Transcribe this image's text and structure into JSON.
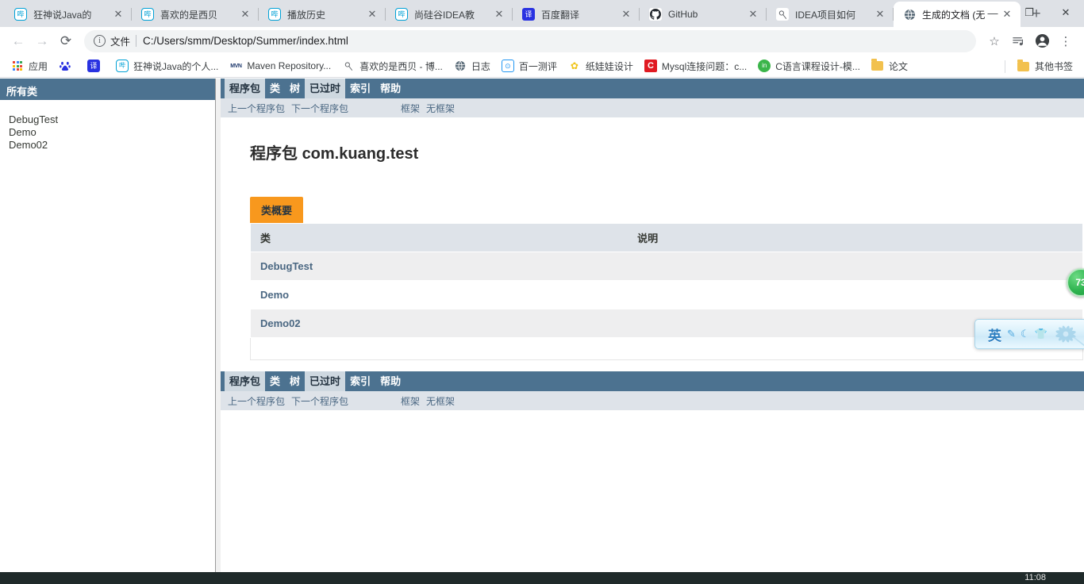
{
  "browser": {
    "tabs": [
      {
        "title": "狂神说Java的",
        "favicon": "bilibili-icon",
        "favicon_glyph": "哔",
        "active": false,
        "closable": true
      },
      {
        "title": "喜欢的是西贝",
        "favicon": "bilibili-icon",
        "favicon_glyph": "哔",
        "active": false,
        "closable": true
      },
      {
        "title": "播放历史",
        "favicon": "bilibili-icon",
        "favicon_glyph": "哔",
        "active": false,
        "closable": true
      },
      {
        "title": "尚硅谷IDEA教",
        "favicon": "bilibili-icon",
        "favicon_glyph": "哔",
        "active": false,
        "closable": true
      },
      {
        "title": "百度翻译",
        "favicon": "translate-icon",
        "favicon_glyph": "译",
        "active": false,
        "closable": true
      },
      {
        "title": "GitHub",
        "favicon": "github-icon",
        "favicon_glyph": "◉",
        "active": false,
        "closable": true
      },
      {
        "title": "IDEA项目如何",
        "favicon": "idea-icon",
        "favicon_glyph": "⌖",
        "active": false,
        "closable": true
      },
      {
        "title": "生成的文档 (无",
        "favicon": "globe-icon",
        "favicon_glyph": "🌐",
        "active": true,
        "closable": true
      }
    ],
    "new_tab_label": "+",
    "close_glyph": "✕",
    "window_controls": {
      "minimize": "—",
      "maximize": "❐",
      "close": "✕"
    },
    "toolbar": {
      "back_glyph": "←",
      "forward_glyph": "→",
      "reload_glyph": "⟳",
      "omnibox": {
        "info_glyph": "i",
        "scheme_label": "文件",
        "url": "C:/Users/smm/Desktop/Summer/index.html"
      },
      "bookmark_star_glyph": "☆",
      "media_glyph": "≡♪",
      "profile_glyph": "●",
      "menu_glyph": "⋮"
    },
    "bookmarks": [
      {
        "label": "应用",
        "icon": "apps-grid-icon",
        "glyph": ""
      },
      {
        "label": "",
        "icon": "baidu-icon",
        "glyph": "百"
      },
      {
        "label": "",
        "icon": "translate-icon",
        "glyph": "译"
      },
      {
        "label": "狂神说Java的个人...",
        "icon": "bilibili-icon",
        "glyph": "哔"
      },
      {
        "label": "Maven Repository...",
        "icon": "maven-icon",
        "glyph": "MVN"
      },
      {
        "label": "喜欢的是西贝 - 博...",
        "icon": "idea-icon",
        "glyph": "⌖"
      },
      {
        "label": "日志",
        "icon": "globe-icon",
        "glyph": "🌐"
      },
      {
        "label": "百一测评",
        "icon": "baiyi-icon",
        "glyph": "⊙"
      },
      {
        "label": "纸娃娃设计",
        "icon": "paperdoll-icon",
        "glyph": "✿"
      },
      {
        "label": "Mysql连接问题：c...",
        "icon": "csdn-icon",
        "glyph": "C"
      },
      {
        "label": "C语言课程设计-模...",
        "icon": "clang-icon",
        "glyph": "in"
      },
      {
        "label": "论文",
        "icon": "folder-icon",
        "glyph": ""
      }
    ],
    "other_bookmarks": {
      "label": "其他书签",
      "icon": "folder-icon"
    }
  },
  "javadoc": {
    "left_frame": {
      "title": "所有类",
      "classes": [
        "DebugTest",
        "Demo",
        "Demo02"
      ]
    },
    "nav": {
      "items": [
        {
          "label": "程序包",
          "state": "current"
        },
        {
          "label": "类",
          "state": "normal"
        },
        {
          "label": "树",
          "state": "normal"
        },
        {
          "label": "已过时",
          "state": "normal"
        },
        {
          "label": "索引",
          "state": "normal"
        },
        {
          "label": "帮助",
          "state": "normal"
        }
      ],
      "sub": {
        "prev": "上一个程序包",
        "next": "下一个程序包",
        "frames": "框架",
        "noframes": "无框架"
      }
    },
    "main": {
      "title_prefix": "程序包",
      "title_package": "com.kuang.test",
      "summary_tab": "类概要",
      "table": {
        "headers": [
          "类",
          "说明"
        ],
        "rows": [
          {
            "class": "DebugTest",
            "description": ""
          },
          {
            "class": "Demo",
            "description": ""
          },
          {
            "class": "Demo02",
            "description": ""
          }
        ]
      }
    }
  },
  "overlays": {
    "green_badge": {
      "label": "73",
      "color": "#2eb34f"
    },
    "ime": {
      "lang": "英",
      "icons": [
        "✎",
        "☾",
        "👕"
      ]
    },
    "taskbar": {
      "clock": "11:08"
    }
  }
}
